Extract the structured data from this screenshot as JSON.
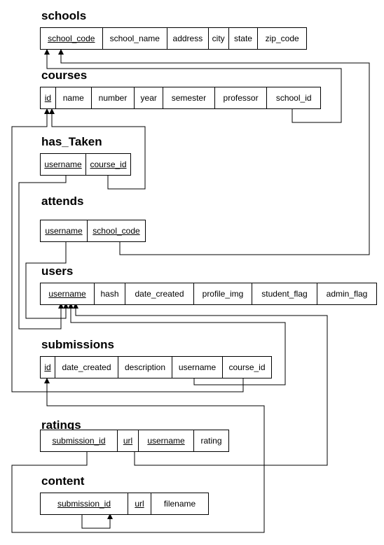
{
  "tables": [
    {
      "id": "schools",
      "name": "schools",
      "columns": [
        {
          "name": "school_code",
          "key": true
        },
        {
          "name": "school_name",
          "key": false
        },
        {
          "name": "address",
          "key": false
        },
        {
          "name": "city",
          "key": false
        },
        {
          "name": "state",
          "key": false
        },
        {
          "name": "zip_code",
          "key": false
        }
      ]
    },
    {
      "id": "courses",
      "name": "courses",
      "columns": [
        {
          "name": "id",
          "key": true
        },
        {
          "name": "name",
          "key": false
        },
        {
          "name": "number",
          "key": false
        },
        {
          "name": "year",
          "key": false
        },
        {
          "name": "semester",
          "key": false
        },
        {
          "name": "professor",
          "key": false
        },
        {
          "name": "school_id",
          "key": false
        }
      ]
    },
    {
      "id": "has_taken",
      "name": "has_Taken",
      "columns": [
        {
          "name": "username",
          "key": true
        },
        {
          "name": "course_id",
          "key": true
        }
      ]
    },
    {
      "id": "attends",
      "name": "attends",
      "columns": [
        {
          "name": "username",
          "key": true
        },
        {
          "name": "school_code",
          "key": true
        }
      ]
    },
    {
      "id": "users",
      "name": "users",
      "columns": [
        {
          "name": "username",
          "key": true
        },
        {
          "name": "hash",
          "key": false
        },
        {
          "name": "date_created",
          "key": false
        },
        {
          "name": "profile_img",
          "key": false
        },
        {
          "name": "student_flag",
          "key": false
        },
        {
          "name": "admin_flag",
          "key": false
        }
      ]
    },
    {
      "id": "submissions",
      "name": "submissions",
      "columns": [
        {
          "name": "id",
          "key": true
        },
        {
          "name": "date_created",
          "key": false
        },
        {
          "name": "description",
          "key": false
        },
        {
          "name": "username",
          "key": false
        },
        {
          "name": "course_id",
          "key": false
        }
      ]
    },
    {
      "id": "ratings",
      "name": "ratings",
      "columns": [
        {
          "name": "submission_id",
          "key": true
        },
        {
          "name": "url",
          "key": true
        },
        {
          "name": "username",
          "key": true
        },
        {
          "name": "rating",
          "key": false
        }
      ]
    },
    {
      "id": "content",
      "name": "content",
      "columns": [
        {
          "name": "submission_id",
          "key": true
        },
        {
          "name": "url",
          "key": true
        },
        {
          "name": "filename",
          "key": false
        }
      ]
    }
  ],
  "relationships": [
    {
      "from": "courses.school_id",
      "to": "schools.school_code"
    },
    {
      "from": "has_Taken.course_id",
      "to": "courses.id"
    },
    {
      "from": "has_Taken.username",
      "to": "users.username"
    },
    {
      "from": "attends.username",
      "to": "users.username"
    },
    {
      "from": "attends.school_code",
      "to": "schools.school_code"
    },
    {
      "from": "submissions.username",
      "to": "users.username"
    },
    {
      "from": "submissions.course_id",
      "to": "courses.id"
    },
    {
      "from": "ratings.submission_id",
      "to": "submissions.id"
    },
    {
      "from": "ratings.url",
      "to": "users.username"
    },
    {
      "from": "content.submission_id",
      "to": "content.url"
    }
  ]
}
